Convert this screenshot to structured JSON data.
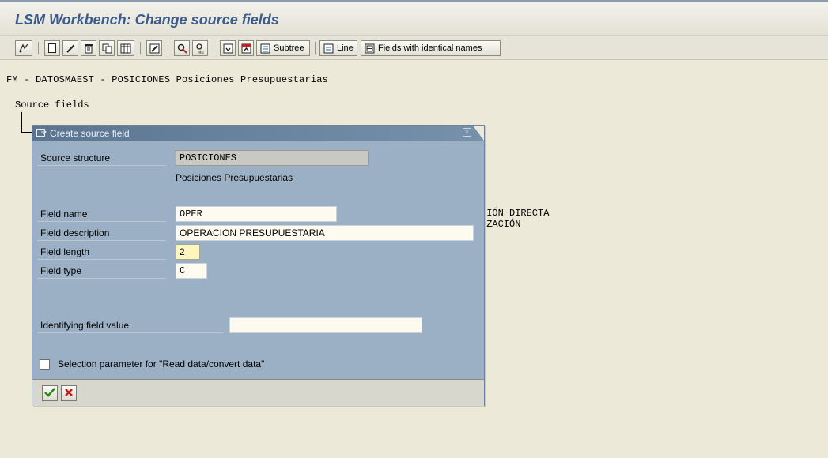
{
  "window": {
    "title": "LSM Workbench: Change source fields"
  },
  "toolbar": {
    "icons": [
      "display-change-icon",
      "create-icon",
      "change-icon",
      "delete-icon",
      "copy-icon",
      "table-icon",
      "edit-icon",
      "find-icon",
      "find-next-icon",
      "expand-icon",
      "collapse-icon"
    ],
    "subtree_label": "Subtree",
    "line_label": "Line",
    "identical_names_label": "Fields with identical names"
  },
  "screen": {
    "header_line": "FM - DATOSMAEST - POSICIONES Posiciones Presupuestarias",
    "tree_root": "Source fields",
    "bg_fragment_1": "CIÓN DIRECTA",
    "bg_fragment_2": "IZACIÓN"
  },
  "dialog": {
    "title": "Create source field",
    "source_structure_label": "Source structure",
    "source_structure_value": "POSICIONES",
    "source_structure_desc": "Posiciones Presupuestarias",
    "field_name_label": "Field name",
    "field_name_value": "OPER",
    "field_description_label": "Field description",
    "field_description_value": "OPERACION PRESUPUESTARIA",
    "field_length_label": "Field length",
    "field_length_value": "2",
    "field_type_label": "Field type",
    "field_type_value": "C",
    "identifying_value_label": "Identifying field value",
    "identifying_value_value": "",
    "selection_param_label": "Selection parameter for \"Read data/convert data\"",
    "selection_param_checked": false
  },
  "colors": {
    "title_text": "#3c5a8e",
    "dialog_bg": "#9bb0c4",
    "dialog_titlebar": "#5b7590",
    "screen_bg": "#ece9d8",
    "confirm_green": "#2a8a1a",
    "cancel_red": "#c0201a"
  }
}
